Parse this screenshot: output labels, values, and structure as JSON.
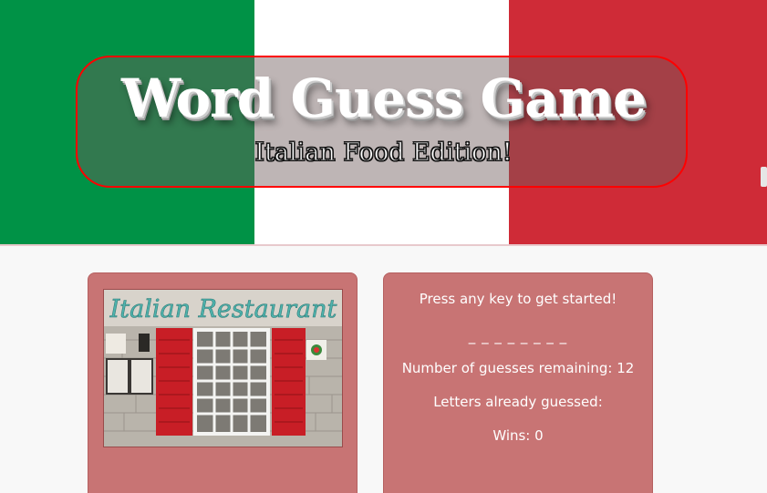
{
  "header": {
    "title": "Word Guess Game",
    "subtitle": "Italian Food Edition!"
  },
  "image": {
    "sign_text": "Italian Restaurant"
  },
  "game": {
    "prompt": "Press any key to get started!",
    "word_blanks": "_ _ _ _ _ _ _ _",
    "guesses_remaining": "Number of guesses remaining: 12",
    "letters_guessed": "Letters already guessed:",
    "wins": "Wins: 0"
  },
  "colors": {
    "flag_green": "#009246",
    "flag_white": "#ffffff",
    "flag_red": "#cf2b37",
    "panel": "#c87474",
    "title_border": "#ff0000"
  }
}
